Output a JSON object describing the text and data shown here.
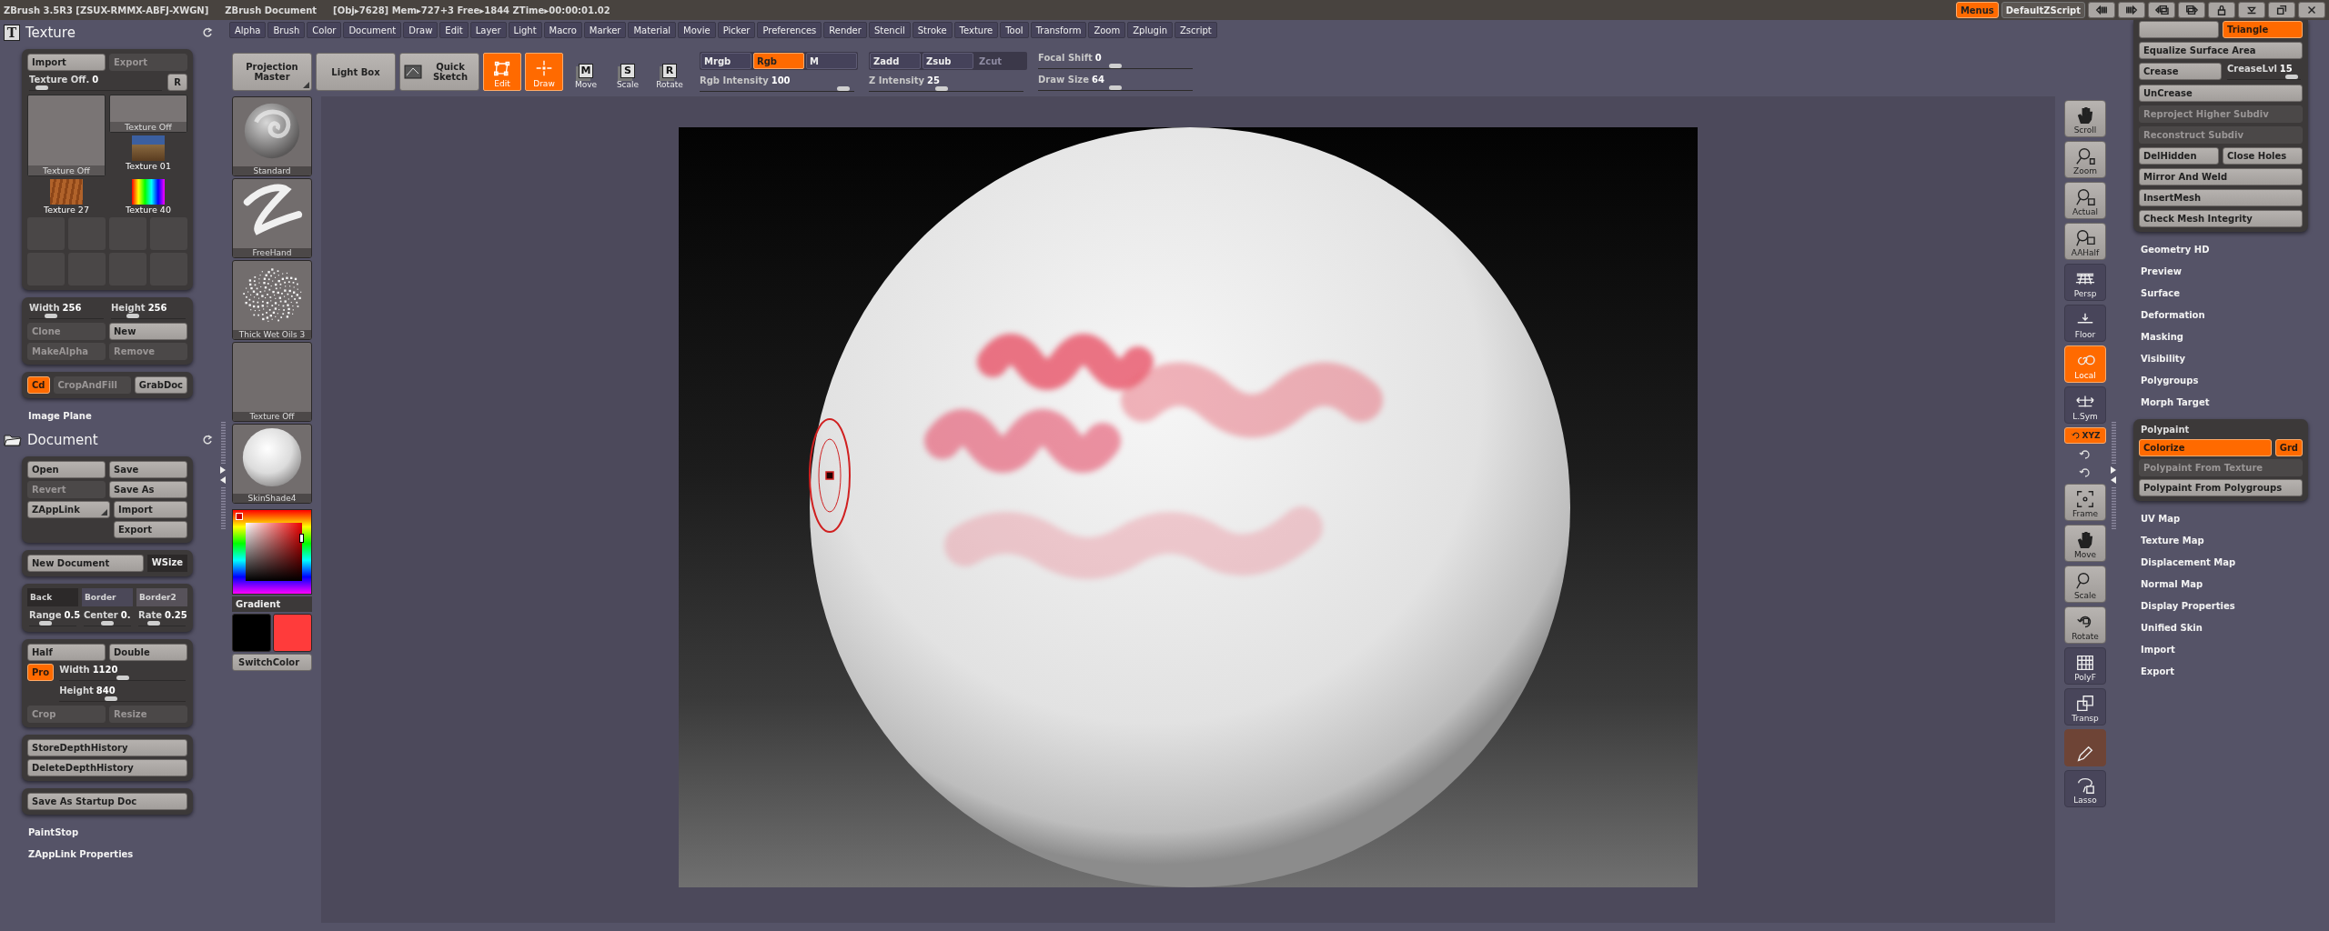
{
  "title_bar": {
    "app": "ZBrush 3.5R3 [ZSUX-RMMX-ABFJ-XWGN]",
    "document": "ZBrush Document",
    "stats": "[Obj▸7628] Mem▸727+3 Free▸1844 ZTime▸00:00:01.02",
    "buttons": [
      {
        "label": "Menus",
        "selected": true
      },
      {
        "label": "DefaultZScript",
        "selected": false
      }
    ]
  },
  "menu_bar": [
    "Alpha",
    "Brush",
    "Color",
    "Document",
    "Draw",
    "Edit",
    "Layer",
    "Light",
    "Macro",
    "Marker",
    "Material",
    "Movie",
    "Picker",
    "Preferences",
    "Render",
    "Stencil",
    "Stroke",
    "Texture",
    "Tool",
    "Transform",
    "Zoom",
    "Zplugin",
    "Zscript"
  ],
  "toolbar": {
    "large_buttons": [
      {
        "label": "Projection Master",
        "menu": true
      },
      {
        "label": "Light Box",
        "menu": false
      },
      {
        "label": "Quick Sketch",
        "menu": false
      }
    ],
    "modes": [
      {
        "label": "Edit",
        "selected": true
      },
      {
        "label": "Draw",
        "selected": true
      },
      {
        "label": "Move",
        "key": "M",
        "selected": false
      },
      {
        "label": "Scale",
        "key": "S",
        "selected": false
      },
      {
        "label": "Rotate",
        "key": "R",
        "selected": false
      }
    ],
    "rgb_modes": [
      {
        "label": "Mrgb",
        "selected": false,
        "disabled": false
      },
      {
        "label": "Rgb",
        "selected": true,
        "disabled": false
      },
      {
        "label": "M",
        "selected": false,
        "disabled": false
      }
    ],
    "z_modes": [
      {
        "label": "Zadd",
        "selected": false,
        "disabled": false
      },
      {
        "label": "Zsub",
        "selected": false,
        "disabled": false
      },
      {
        "label": "Zcut",
        "selected": false,
        "disabled": true
      }
    ],
    "sliders": [
      {
        "label": "Rgb Intensity",
        "value": "100",
        "level": 0.97
      },
      {
        "label": "Z Intensity",
        "value": "25",
        "level": 0.47
      },
      {
        "label": "Focal Shift",
        "value": "0",
        "level": 0.5
      },
      {
        "label": "Draw Size",
        "value": "64",
        "level": 0.5
      }
    ]
  },
  "left_panel": [
    {
      "kind": "title",
      "label": "Texture",
      "icon_text": "T"
    },
    {
      "kind": "group",
      "rows": [
        [
          {
            "kind": "button",
            "label": "Import",
            "disabled": false
          },
          {
            "kind": "button",
            "label": "Export",
            "disabled": true
          }
        ],
        [
          {
            "kind": "slider",
            "label": "Texture Off.",
            "value": "0",
            "level": 0.05
          },
          {
            "kind": "key",
            "label": "R",
            "disabled": false
          }
        ],
        [
          {
            "kind": "thumb_empty_large",
            "label": "Texture Off"
          },
          {
            "kind": "column",
            "items": [
              {
                "kind": "thumb_empty",
                "label": "Texture Off"
              },
              {
                "kind": "thumb_photo",
                "label": "Texture 01"
              }
            ]
          }
        ],
        [
          {
            "kind": "thumb_wood",
            "label": "Texture 27"
          },
          {
            "kind": "thumb_spectrum",
            "label": "Texture 40"
          }
        ],
        [
          {
            "kind": "tile",
            "disabled": true
          },
          {
            "kind": "tile",
            "disabled": true
          },
          {
            "kind": "tile",
            "disabled": true
          },
          {
            "kind": "tile",
            "disabled": true
          }
        ],
        [
          {
            "kind": "tile",
            "disabled": true
          },
          {
            "kind": "tile",
            "disabled": true
          },
          {
            "kind": "tile",
            "disabled": true
          },
          {
            "kind": "tile",
            "disabled": true
          }
        ]
      ]
    },
    {
      "kind": "group",
      "rows": [
        [
          {
            "kind": "slider",
            "label": "Width",
            "value": "256",
            "level": 0.25
          },
          {
            "kind": "slider",
            "label": "Height",
            "value": "256",
            "level": 0.25
          }
        ],
        [
          {
            "kind": "button",
            "label": "Clone",
            "disabled": true
          },
          {
            "kind": "button",
            "label": "New",
            "disabled": false
          }
        ],
        [
          {
            "kind": "button",
            "label": "MakeAlpha",
            "disabled": true
          },
          {
            "kind": "button",
            "label": "Remove",
            "disabled": true
          }
        ]
      ]
    },
    {
      "kind": "group",
      "rows": [
        [
          {
            "kind": "key",
            "label": "Cd",
            "selected": true,
            "disabled": false
          },
          {
            "kind": "button",
            "label": "CropAndFill",
            "disabled": true
          },
          {
            "kind": "key",
            "label": "GrabDoc",
            "disabled": false
          }
        ]
      ]
    },
    {
      "kind": "heading",
      "label": "Image Plane"
    },
    {
      "kind": "title",
      "label": "Document"
    },
    {
      "kind": "group",
      "rows": [
        [
          {
            "kind": "button",
            "label": "Open",
            "disabled": false
          },
          {
            "kind": "button",
            "label": "Save",
            "disabled": false
          }
        ],
        [
          {
            "kind": "button",
            "label": "Revert",
            "disabled": true
          },
          {
            "kind": "button",
            "label": "Save As",
            "disabled": false
          }
        ],
        [
          {
            "kind": "button",
            "label": "ZAppLink",
            "menu": true,
            "disabled": false
          },
          {
            "kind": "column",
            "items": [
              {
                "kind": "button",
                "label": "Import",
                "disabled": false
              },
              {
                "kind": "button",
                "label": "Export",
                "disabled": false
              }
            ]
          }
        ]
      ]
    },
    {
      "kind": "group",
      "rows": [
        [
          {
            "kind": "button",
            "label": "New Document",
            "disabled": false
          },
          {
            "kind": "label",
            "label": "WSize"
          }
        ]
      ]
    },
    {
      "kind": "group",
      "rows": [
        [
          {
            "kind": "swatch",
            "label": "Back",
            "color": "#2c2929"
          },
          {
            "kind": "swatch",
            "label": "Border",
            "color": "#4b4858"
          },
          {
            "kind": "swatch",
            "label": "Border2",
            "color": "#57525a"
          }
        ],
        [
          {
            "kind": "slider",
            "label": "Range",
            "value": "0.5",
            "level": 0.3
          },
          {
            "kind": "slider",
            "label": "Center",
            "value": "0.",
            "level": 0.5
          },
          {
            "kind": "slider",
            "label": "Rate",
            "value": "0.25",
            "level": 0.25
          }
        ]
      ]
    },
    {
      "kind": "group",
      "rows": [
        [
          {
            "kind": "button",
            "label": "Half",
            "disabled": false
          },
          {
            "kind": "button",
            "label": "Double",
            "disabled": false
          }
        ],
        [
          {
            "kind": "key",
            "label": "Pro",
            "selected": true,
            "disabled": false
          },
          {
            "kind": "column",
            "items": [
              {
                "kind": "slider",
                "label": "Width",
                "value": "1120",
                "level": 0.5
              },
              {
                "kind": "slider",
                "label": "Height",
                "value": "840",
                "level": 0.4
              }
            ]
          }
        ],
        [
          {
            "kind": "button",
            "label": "Crop",
            "disabled": true
          },
          {
            "kind": "button",
            "label": "Resize",
            "disabled": true
          }
        ]
      ]
    },
    {
      "kind": "group",
      "rows": [
        [
          {
            "kind": "button",
            "label": "StoreDepthHistory",
            "disabled": false
          }
        ],
        [
          {
            "kind": "button",
            "label": "DeleteDepthHistory",
            "disabled": false
          }
        ]
      ]
    },
    {
      "kind": "group",
      "rows": [
        [
          {
            "kind": "button",
            "label": "Save As Startup Doc",
            "disabled": false
          }
        ]
      ]
    },
    {
      "kind": "heading",
      "label": "PaintStop"
    },
    {
      "kind": "heading",
      "label": "ZAppLink Properties"
    }
  ],
  "brush_column": {
    "items": [
      {
        "label": "Standard",
        "kind": "brush"
      },
      {
        "label": "FreeHand",
        "kind": "stroke"
      },
      {
        "label": "Thick Wet Oils 3",
        "kind": "alpha"
      },
      {
        "label": "Texture Off",
        "kind": "texture"
      },
      {
        "label": "SkinShade4",
        "kind": "material"
      }
    ],
    "picker_label": "Gradient",
    "swatches": [
      {
        "color": "#000000"
      },
      {
        "color": "#ff3b3b"
      }
    ],
    "switch_label": "SwitchColor"
  },
  "view_tools": [
    {
      "kind": "action",
      "label": "Scroll"
    },
    {
      "kind": "action",
      "label": "Zoom"
    },
    {
      "kind": "action",
      "label": "Actual"
    },
    {
      "kind": "action",
      "label": "AAHalf"
    },
    {
      "kind": "toggle",
      "label": "Persp",
      "selected": false,
      "disabled": false
    },
    {
      "kind": "toggle",
      "label": "Floor",
      "selected": false,
      "disabled": false
    },
    {
      "kind": "toggle",
      "label": "Local",
      "selected": true,
      "disabled": false
    },
    {
      "kind": "toggle",
      "label": "L.Sym",
      "selected": false,
      "disabled": false
    },
    {
      "kind": "pill",
      "label": "XYZ",
      "selected": true
    },
    {
      "kind": "mini"
    },
    {
      "kind": "mini"
    },
    {
      "kind": "action",
      "label": "Frame"
    },
    {
      "kind": "action",
      "label": "Move"
    },
    {
      "kind": "action",
      "label": "Scale"
    },
    {
      "kind": "action",
      "label": "Rotate"
    },
    {
      "kind": "toggle",
      "label": "PolyF",
      "selected": false,
      "disabled": false
    },
    {
      "kind": "toggle",
      "label": "Transp",
      "selected": false,
      "disabled": false
    },
    {
      "kind": "toggle",
      "selected": false,
      "disabled": true
    },
    {
      "kind": "toggle",
      "label": "Lasso",
      "selected": false,
      "disabled": false
    }
  ],
  "right_panel": [
    {
      "kind": "group",
      "rows": [
        [
          {
            "kind": "button",
            "disabled": false
          },
          {
            "kind": "button",
            "label": "Triangle",
            "selected": true,
            "disabled": false
          }
        ],
        [
          {
            "kind": "button",
            "label": "Equalize Surface Area",
            "disabled": false
          }
        ],
        [
          {
            "kind": "button",
            "label": "Crease",
            "disabled": false
          },
          {
            "kind": "slider",
            "label": "CreaseLvl",
            "value": "15",
            "level": 0.95
          }
        ],
        [
          {
            "kind": "button",
            "label": "UnCrease",
            "disabled": false
          }
        ],
        [
          {
            "kind": "button",
            "label": "Reproject Higher Subdiv",
            "disabled": true
          }
        ],
        [
          {
            "kind": "button",
            "label": "Reconstruct Subdiv",
            "disabled": true
          }
        ],
        [
          {
            "kind": "button",
            "label": "DelHidden",
            "disabled": false
          },
          {
            "kind": "button",
            "label": "Close Holes",
            "disabled": false
          }
        ],
        [
          {
            "kind": "button",
            "label": "Mirror And Weld",
            "disabled": false
          }
        ],
        [
          {
            "kind": "button",
            "label": "InsertMesh",
            "disabled": false
          }
        ],
        [
          {
            "kind": "button",
            "label": "Check Mesh Integrity",
            "disabled": false
          }
        ]
      ]
    },
    {
      "kind": "heading",
      "label": "Geometry HD"
    },
    {
      "kind": "heading",
      "label": "Preview"
    },
    {
      "kind": "heading",
      "label": "Surface"
    },
    {
      "kind": "heading",
      "label": "Deformation"
    },
    {
      "kind": "heading",
      "label": "Masking"
    },
    {
      "kind": "heading",
      "label": "Visibility"
    },
    {
      "kind": "heading",
      "label": "Polygroups"
    },
    {
      "kind": "heading",
      "label": "Morph Target"
    },
    {
      "kind": "group",
      "title": "Polypaint",
      "rows": [
        [
          {
            "kind": "button",
            "label": "Colorize",
            "selected": true,
            "disabled": false
          },
          {
            "kind": "key",
            "label": "Grd",
            "selected": true,
            "disabled": false
          }
        ],
        [
          {
            "kind": "button",
            "label": "Polypaint From Texture",
            "disabled": true
          }
        ],
        [
          {
            "kind": "button",
            "label": "Polypaint From Polygroups",
            "disabled": false
          }
        ]
      ]
    },
    {
      "kind": "heading",
      "label": "UV Map"
    },
    {
      "kind": "heading",
      "label": "Texture Map"
    },
    {
      "kind": "heading",
      "label": "Displacement Map"
    },
    {
      "kind": "heading",
      "label": "Normal Map"
    },
    {
      "kind": "heading",
      "label": "Display Properties"
    },
    {
      "kind": "heading",
      "label": "Unified Skin"
    },
    {
      "kind": "heading",
      "label": "Import"
    },
    {
      "kind": "heading",
      "label": "Export"
    }
  ]
}
